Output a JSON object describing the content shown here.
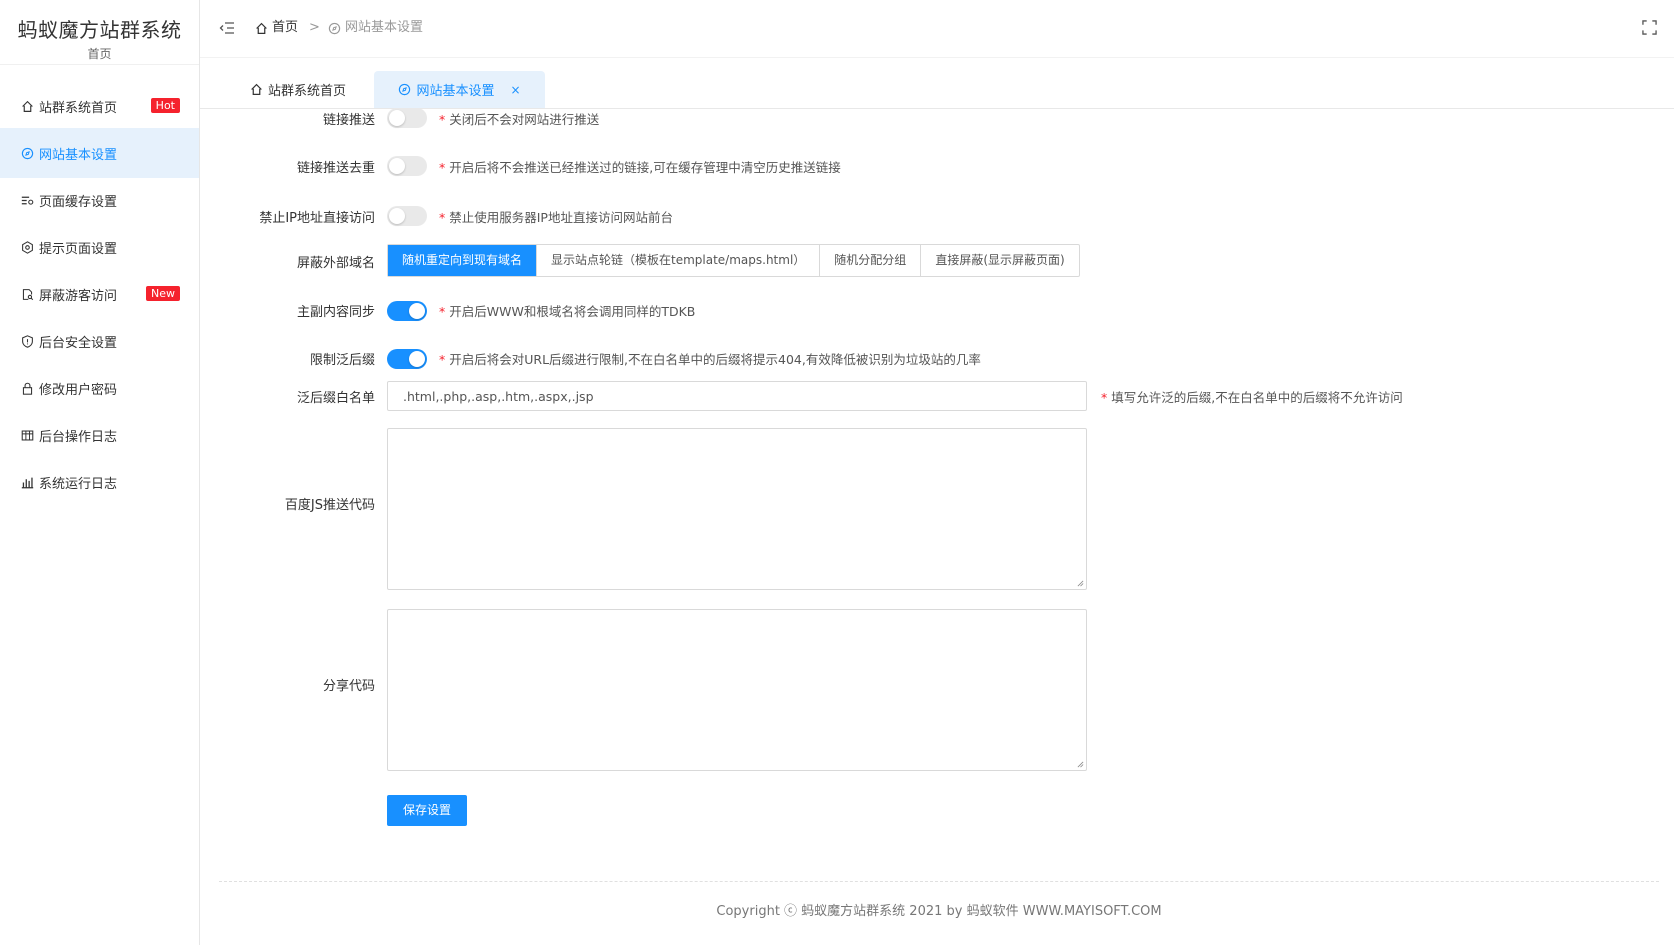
{
  "sidebar": {
    "title": "蚂蚁魔方站群系统",
    "subtitle": "首页",
    "items": [
      {
        "label": "站群系统首页",
        "badge": "Hot"
      },
      {
        "label": "网站基本设置",
        "badge": ""
      },
      {
        "label": "页面缓存设置",
        "badge": ""
      },
      {
        "label": "提示页面设置",
        "badge": ""
      },
      {
        "label": "屏蔽游客访问",
        "badge": "New"
      },
      {
        "label": "后台安全设置",
        "badge": ""
      },
      {
        "label": "修改用户密码",
        "badge": ""
      },
      {
        "label": "后台操作日志",
        "badge": ""
      },
      {
        "label": "系统运行日志",
        "badge": ""
      }
    ]
  },
  "breadcrumb": {
    "home": "首页",
    "separator": ">",
    "current": "网站基本设置"
  },
  "tabs": [
    {
      "label": "站群系统首页"
    },
    {
      "label": "网站基本设置",
      "close": "×"
    }
  ],
  "form": {
    "link_push": {
      "label": "链接推送",
      "tip": "关闭后不会对网站进行推送",
      "on": false
    },
    "link_push_dedupe": {
      "label": "链接推送去重",
      "tip": "开启后将不会推送已经推送过的链接,可在缓存管理中清空历史推送链接",
      "on": false
    },
    "block_ip_access": {
      "label": "禁止IP地址直接访问",
      "tip": "禁止使用服务器IP地址直接访问网站前台",
      "on": false
    },
    "block_external_domain": {
      "label": "屏蔽外部域名",
      "options": [
        "随机重定向到现有域名",
        "显示站点轮链（模板在template/maps.html）",
        "随机分配分组",
        "直接屏蔽(显示屏蔽页面)"
      ],
      "selected": "随机重定向到现有域名"
    },
    "main_sub_sync": {
      "label": "主副内容同步",
      "tip": "开启后WWW和根域名将会调用同样的TDKB",
      "on": true
    },
    "limit_suffix": {
      "label": "限制泛后缀",
      "tip": "开启后将会对URL后缀进行限制,不在白名单中的后缀将提示404,有效降低被识别为垃圾站的几率",
      "on": true
    },
    "suffix_whitelist": {
      "label": "泛后缀白名单",
      "value": ".html,.php,.asp,.htm,.aspx,.jsp",
      "tip": "填写允许泛的后缀,不在白名单中的后缀将不允许访问"
    },
    "baidu_js": {
      "label": "百度JS推送代码",
      "value": ""
    },
    "share_code": {
      "label": "分享代码",
      "value": ""
    },
    "tip_star": "*",
    "save_label": "保存设置"
  },
  "footer": {
    "text": "Copyright ⓒ 蚂蚁魔方站群系统 2021 by 蚂蚁软件 WWW.MAYISOFT.COM"
  },
  "colors": {
    "accent": "#1890ff",
    "badge": "#f5222d",
    "active_bg": "#e6f1fc"
  }
}
